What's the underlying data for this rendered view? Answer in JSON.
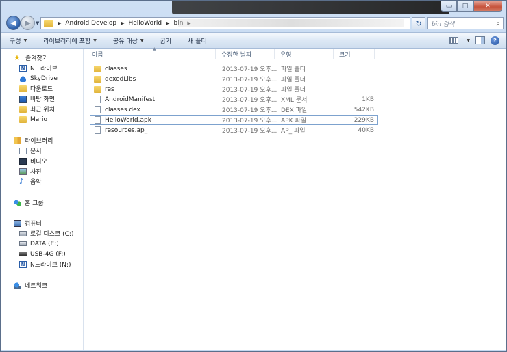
{
  "window": {
    "min_glyph": "▭",
    "max_glyph": "□",
    "close_glyph": "✕"
  },
  "address": {
    "crumbs": [
      "Android Develop",
      "HelloWorld",
      "bin"
    ],
    "refresh_glyph": "↻"
  },
  "search": {
    "placeholder": "bin 검색",
    "icon": "search-icon"
  },
  "toolbar": {
    "organize": "구성",
    "include_library": "라이브러리에 포함",
    "share_with": "공유 대상",
    "burn": "굽기",
    "new_folder": "새 폴더",
    "help": "?"
  },
  "nav": {
    "favorites": {
      "label": "즐겨찾기",
      "items": [
        "N드라이브",
        "SkyDrive",
        "다운로드",
        "바탕 화면",
        "최근 위치",
        "Mario"
      ]
    },
    "libraries": {
      "label": "라이브러리",
      "items": [
        "문서",
        "비디오",
        "사진",
        "음악"
      ]
    },
    "homegroup": {
      "label": "홈 그룹"
    },
    "computer": {
      "label": "컴퓨터",
      "items": [
        "로컬 디스크 (C:)",
        "DATA (E:)",
        "USB-4G (F:)",
        "N드라이브 (N:)"
      ]
    },
    "network": {
      "label": "네트워크"
    }
  },
  "columns": {
    "name": "이름",
    "date": "수정한 날짜",
    "type": "유형",
    "size": "크기"
  },
  "files": [
    {
      "name": "classes",
      "date": "2013-07-19 오후...",
      "type": "파일 폴더",
      "size": "",
      "kind": "folder"
    },
    {
      "name": "dexedLibs",
      "date": "2013-07-19 오후...",
      "type": "파일 폴더",
      "size": "",
      "kind": "folder"
    },
    {
      "name": "res",
      "date": "2013-07-19 오후...",
      "type": "파일 폴더",
      "size": "",
      "kind": "folder"
    },
    {
      "name": "AndroidManifest",
      "date": "2013-07-19 오후...",
      "type": "XML 문서",
      "size": "1KB",
      "kind": "file"
    },
    {
      "name": "classes.dex",
      "date": "2013-07-19 오후...",
      "type": "DEX 파일",
      "size": "542KB",
      "kind": "file"
    },
    {
      "name": "HelloWorld.apk",
      "date": "2013-07-19 오후...",
      "type": "APK 파일",
      "size": "229KB",
      "kind": "file",
      "selected": true
    },
    {
      "name": "resources.ap_",
      "date": "2013-07-19 오후...",
      "type": "AP_ 파일",
      "size": "40KB",
      "kind": "file"
    }
  ]
}
